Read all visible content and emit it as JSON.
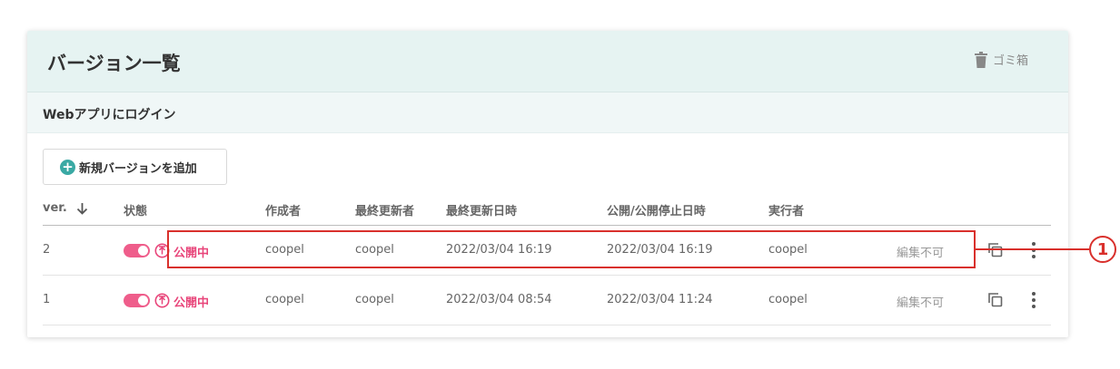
{
  "header": {
    "title": "バージョン一覧",
    "trash_label": "ゴミ箱"
  },
  "app": {
    "name": "Webアプリにログイン"
  },
  "add_button": {
    "label": "新規バージョンを追加"
  },
  "table": {
    "columns": {
      "version": "ver.",
      "status": "状態",
      "creator": "作成者",
      "last_updater": "最終更新者",
      "last_updated": "最終更新日時",
      "publish_time": "公開/公開停止日時",
      "executor": "実行者"
    },
    "rows": [
      {
        "version": "2",
        "toggle_on": true,
        "status": "公開中",
        "creator": "coopel",
        "last_updater": "coopel",
        "last_updated": "2022/03/04 16:19",
        "publish_time": "2022/03/04 16:19",
        "executor": "coopel",
        "edit_note": "編集不可"
      },
      {
        "version": "1",
        "toggle_on": true,
        "status": "公開中",
        "creator": "coopel",
        "last_updater": "coopel",
        "last_updated": "2022/03/04 08:54",
        "publish_time": "2022/03/04 11:24",
        "executor": "coopel",
        "edit_note": "編集不可"
      }
    ]
  },
  "callout": {
    "number": "1"
  },
  "colors": {
    "accent_pink": "#e8457a",
    "teal": "#3aa9a4",
    "header_bg": "#e6f3f2",
    "callout_red": "#d9302c"
  },
  "icons": {
    "trash": "trash-icon",
    "plus": "plus-circle-icon",
    "sort": "arrow-down-icon",
    "upload": "upload-circle-icon",
    "copy": "copy-icon",
    "more": "more-vertical-icon"
  }
}
